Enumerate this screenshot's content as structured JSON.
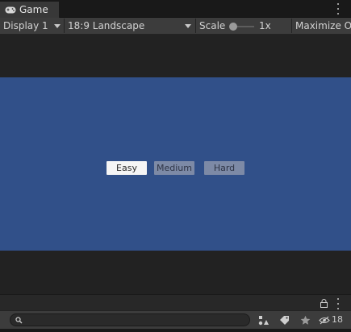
{
  "window": {
    "tab_label": "Game",
    "tab_icon": "gamepad-icon"
  },
  "toolbar": {
    "display_label": "Display 1",
    "aspect_label": "18:9 Landscape",
    "scale_label": "Scale",
    "scale_value": "1x",
    "scale_slider_level": 0,
    "maximize_label": "Maximize O"
  },
  "game": {
    "background_color": "#315089",
    "buttons": [
      {
        "label": "Easy",
        "state": "selected"
      },
      {
        "label": "Medium",
        "state": "normal"
      },
      {
        "label": "Hard",
        "state": "normal"
      }
    ]
  },
  "bottom": {
    "search_placeholder": "",
    "visibility_count": "18",
    "icons": [
      "lock-icon",
      "kebab-menu-icon",
      "search-icon",
      "object-filter-icon",
      "tag-icon",
      "star-icon",
      "hidden-eye-icon"
    ]
  },
  "colors": {
    "editor_background": "#282828",
    "toolbar_background": "#3c3c3c",
    "game_view_background": "#315089"
  }
}
